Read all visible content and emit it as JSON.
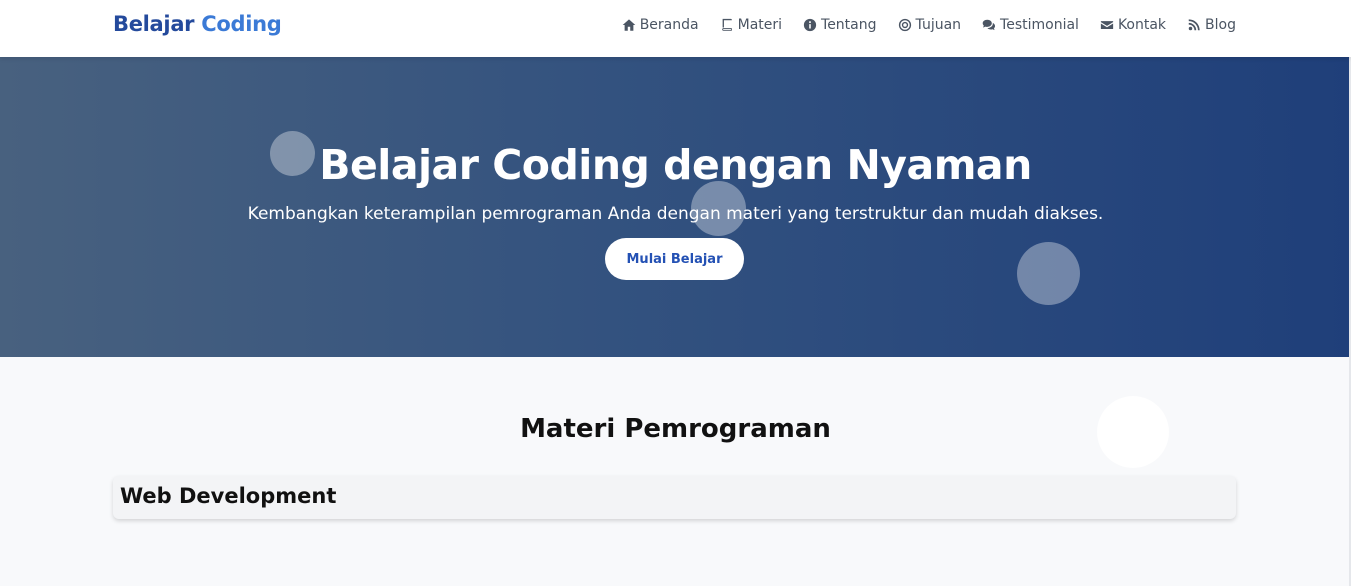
{
  "brand": {
    "part1": "Belajar",
    "part2": "Coding"
  },
  "nav": {
    "items": [
      {
        "label": "Beranda",
        "icon": "home-icon"
      },
      {
        "label": "Materi",
        "icon": "book-icon"
      },
      {
        "label": "Tentang",
        "icon": "info-icon"
      },
      {
        "label": "Tujuan",
        "icon": "target-icon"
      },
      {
        "label": "Testimonial",
        "icon": "comments-icon"
      },
      {
        "label": "Kontak",
        "icon": "envelope-icon"
      },
      {
        "label": "Blog",
        "icon": "blog-icon"
      }
    ]
  },
  "hero": {
    "title": "Belajar Coding dengan Nyaman",
    "subtitle": "Kembangkan keterampilan pemrograman Anda dengan materi yang terstruktur dan mudah diakses.",
    "button_label": "Mulai Belajar"
  },
  "materi": {
    "title": "Materi Pemrograman",
    "cards": [
      {
        "title": "Web Development"
      }
    ]
  },
  "colors": {
    "brand_dark": "#244a9c",
    "brand_light": "#3b7ad6",
    "hero_start": "#48617f",
    "hero_end": "#1f3f7a",
    "button_text": "#2451b4"
  }
}
